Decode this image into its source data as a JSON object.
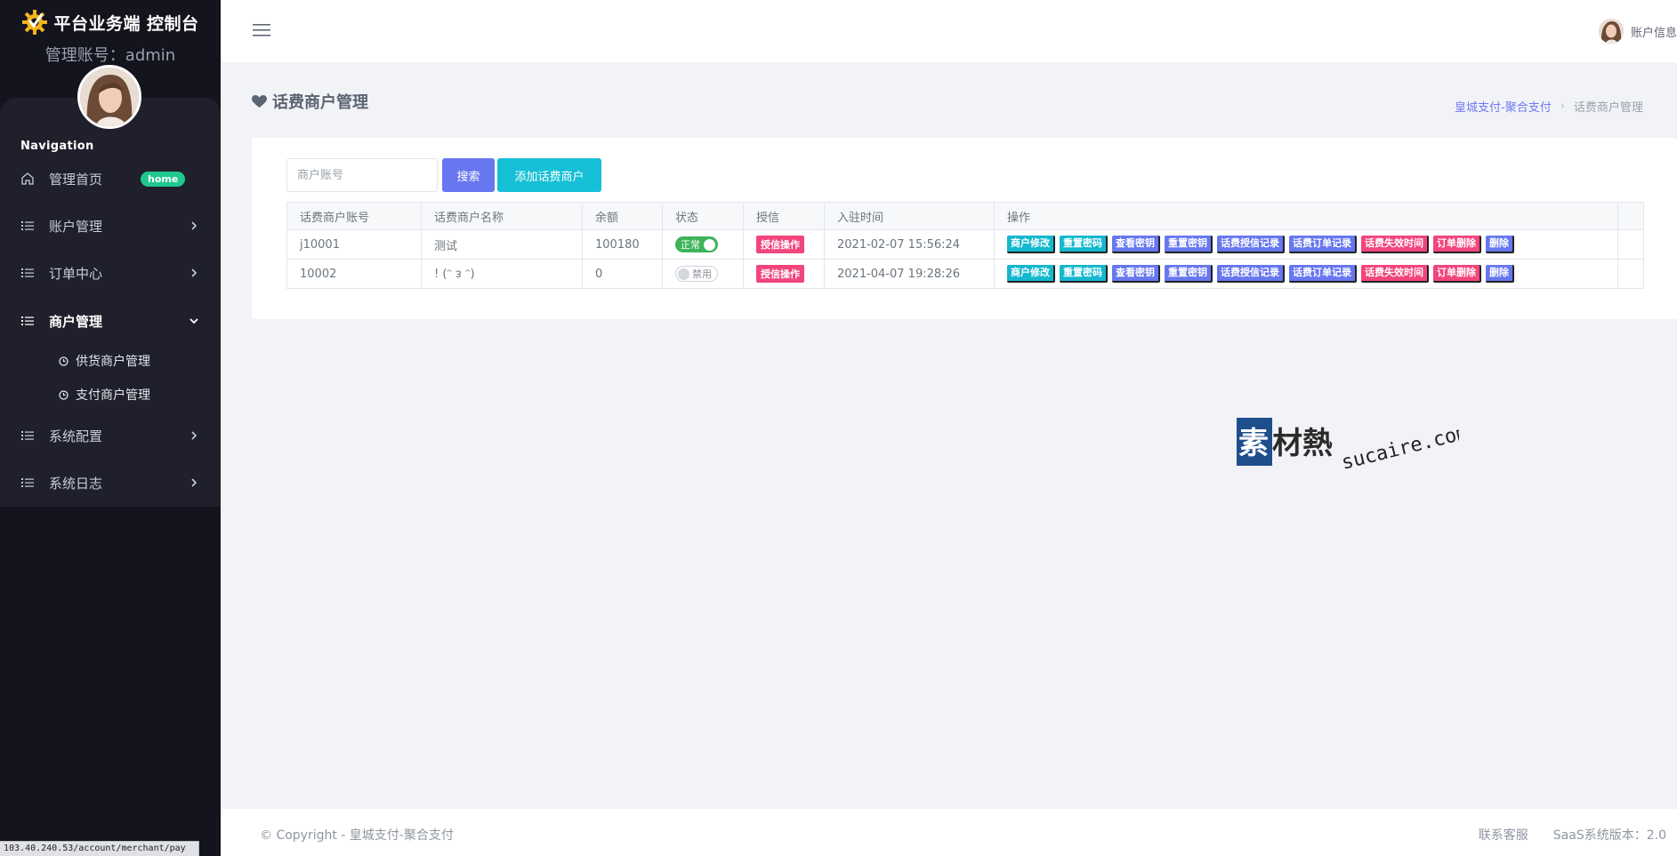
{
  "sidebar": {
    "brand_title": "平台业务端 控制台",
    "admin_line": "管理账号：admin",
    "nav_caption": "Navigation",
    "home_badge": "home",
    "items": [
      {
        "label": "管理首页",
        "icon": "home-icon"
      },
      {
        "label": "账户管理",
        "icon": "list-icon"
      },
      {
        "label": "订单中心",
        "icon": "list-icon"
      },
      {
        "label": "商户管理",
        "icon": "list-icon"
      },
      {
        "label": "系统配置",
        "icon": "list-icon"
      },
      {
        "label": "系统日志",
        "icon": "list-icon"
      }
    ],
    "sub_items": [
      {
        "label": "供货商户管理",
        "icon": "clock-icon"
      },
      {
        "label": "支付商户管理",
        "icon": "clock-icon"
      }
    ],
    "status_url": "103.40.240.53/account/merchant/pay"
  },
  "topbar": {
    "account_label": "账户信息"
  },
  "page": {
    "title": "话费商户管理",
    "title_icon": "heart-icon",
    "breadcrumb": {
      "home": "皇城支付-聚合支付",
      "current": "话费商户管理"
    }
  },
  "filter": {
    "placeholder": "商户账号",
    "search_label": "搜索",
    "add_label": "添加话费商户"
  },
  "table": {
    "headers": [
      "话费商户账号",
      "话费商户名称",
      "余额",
      "状态",
      "授信",
      "入驻时间",
      "操作"
    ],
    "rows": [
      {
        "account": "j10001",
        "name": "测试",
        "balance": "100180",
        "status": "正常",
        "status_on": true,
        "credit": "授信操作",
        "joined": "2021-02-07 15:56:24"
      },
      {
        "account": "10002",
        "name": "! (ᵔ ᴈ ᵔ)",
        "balance": "0",
        "status": "禁用",
        "status_on": false,
        "credit": "授信操作",
        "joined": "2021-04-07 19:28:26"
      }
    ],
    "actions": [
      "商户修改",
      "重置密码",
      "查看密钥",
      "重置密钥",
      "话费授信记录",
      "话费订单记录",
      "话费失效时间",
      "订单删除",
      "删除"
    ],
    "action_colors": [
      "#14b8cf",
      "#14b8cf",
      "#6777ef",
      "#6777ef",
      "#6777ef",
      "#6777ef",
      "#f2457c",
      "#f2457c",
      "#6777ef"
    ]
  },
  "watermark": {
    "brand": "素材熱",
    "domain": "sucaire.com"
  },
  "footer": {
    "copyright": "© Copyright - 皇城支付-聚合支付",
    "contact": "联系客服",
    "version": "SaaS系统版本：2.0"
  },
  "colors": {
    "sidebar_bg": "#13141d",
    "primary": "#6777ef",
    "cyan": "#15c0d6",
    "pink": "#f2457c",
    "success": "#3db35a",
    "badge_green": "#1ec88f"
  }
}
